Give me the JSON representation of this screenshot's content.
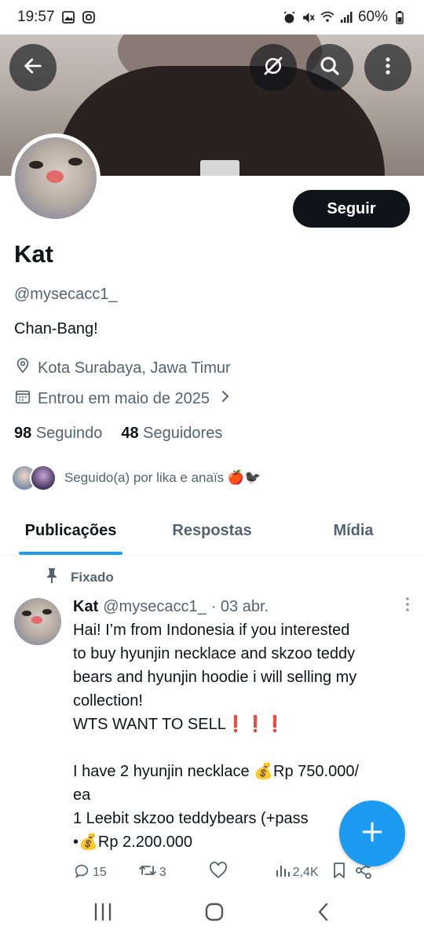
{
  "status_bar": {
    "time": "19:57",
    "battery": "60%"
  },
  "header": {
    "back_icon": "arrow-left-icon",
    "grok_icon": "grok-icon",
    "search_icon": "search-icon",
    "more_icon": "more-vertical-icon"
  },
  "profile": {
    "follow_label": "Seguir",
    "name": "Kat",
    "handle": "@mysecacc1_",
    "bio": "Chan-Bang!",
    "location": "Kota Surabaya, Jawa Timur",
    "joined": "Entrou em maio de 2025",
    "following_count": "98",
    "following_label": "Seguindo",
    "followers_count": "48",
    "followers_label": "Seguidores",
    "followed_by": "Seguido(a) por lika e anaïs 🍎🐦‍⬛"
  },
  "tabs": [
    {
      "label": "Publicações",
      "active": true
    },
    {
      "label": "Respostas",
      "active": false
    },
    {
      "label": "Mídia",
      "active": false
    }
  ],
  "post": {
    "pinned_label": "Fixado",
    "author_name": "Kat",
    "author_handle": "@mysecacc1_",
    "date": "· 03 abr.",
    "lines": [
      "Hai! I’m from Indonesia if you interested",
      "to buy hyunjin necklace and skzoo teddy",
      "bears and hyunjin hoodie i will selling my",
      "collection!",
      "WTS WANT TO SELL❗❗❗",
      "",
      "I have 2 hyunjin necklace 💰Rp 750.000/",
      "ea",
      "1 Leebit skzoo teddybears (+pass",
      "•💰Rp 2.200.000"
    ],
    "replies": "15",
    "reposts": "3",
    "views": "2,4K"
  },
  "colors": {
    "accent": "#1d9bf0",
    "text": "#0f1419",
    "muted": "#536471"
  }
}
